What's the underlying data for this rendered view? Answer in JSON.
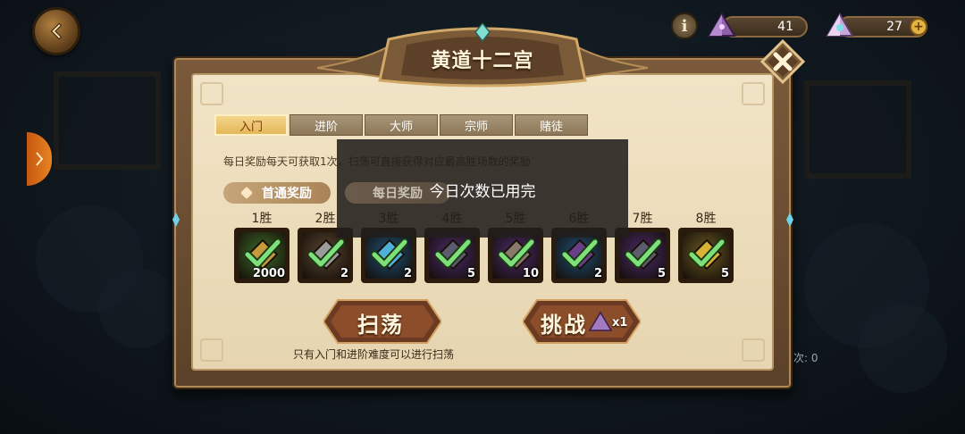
{
  "hud": {
    "currency1_value": "41",
    "currency2_value": "27",
    "info_label": "i",
    "plus_label": "+"
  },
  "dialog": {
    "title": "黄道十二宫",
    "tabs": [
      {
        "label": "入门",
        "active": true
      },
      {
        "label": "进阶",
        "active": false
      },
      {
        "label": "大师",
        "active": false
      },
      {
        "label": "宗师",
        "active": false
      },
      {
        "label": "赌徒",
        "active": false
      }
    ],
    "description": "每日奖励每天可获取1次，扫荡可直接获得对应最高胜场数的奖励",
    "first_clear_label": "首通奖励",
    "daily_label": "每日奖励",
    "rewards": [
      {
        "win": "1胜",
        "count": "2000",
        "bg": "#3e6b2a",
        "item": "#c59a3b"
      },
      {
        "win": "2胜",
        "count": "2",
        "bg": "#5a4631",
        "item": "#9b9b9b"
      },
      {
        "win": "3胜",
        "count": "2",
        "bg": "#1d4f74",
        "item": "#4fb0d8"
      },
      {
        "win": "4胜",
        "count": "5",
        "bg": "#4a2a6a",
        "item": "#5c5c6e"
      },
      {
        "win": "5胜",
        "count": "10",
        "bg": "#4a2a6a",
        "item": "#8a7a6c"
      },
      {
        "win": "6胜",
        "count": "2",
        "bg": "#1d4f74",
        "item": "#6a3f8a"
      },
      {
        "win": "7胜",
        "count": "5",
        "bg": "#4a2a6a",
        "item": "#5c5c6e"
      },
      {
        "win": "8胜",
        "count": "5",
        "bg": "#6a5a22",
        "item": "#d7b234"
      }
    ],
    "sweep_label": "扫荡",
    "challenge_label": "挑战",
    "challenge_cost": "x1",
    "note": "只有入门和进阶难度可以进行扫荡"
  },
  "toast": {
    "message": "今日次数已用完"
  },
  "background": {
    "right_hint": "次: 0"
  },
  "colors": {
    "accent_gold": "#e4b75a",
    "check_green": "#7ee07a"
  }
}
